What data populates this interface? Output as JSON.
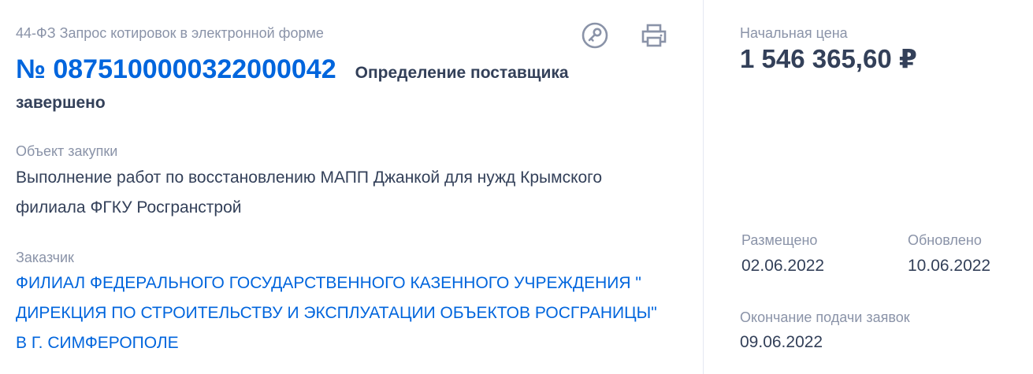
{
  "header": {
    "law_and_method": "44-ФЗ Запрос котировок в электронной форме",
    "number": "№ 0875100000322000042",
    "status": "Определение поставщика завершено",
    "actions": {
      "key_icon": "key-icon",
      "print_icon": "print-icon"
    }
  },
  "object": {
    "label": "Объект закупки",
    "text": "Выполнение работ по восстановлению МАПП Джанкой для нужд Крымского филиала ФГКУ Росгранстрой"
  },
  "customer": {
    "label": "Заказчик",
    "name": "ФИЛИАЛ ФЕДЕРАЛЬНОГО ГОСУДАРСТВЕННОГО КАЗЕННОГО УЧРЕЖДЕНИЯ \" ДИРЕКЦИЯ ПО СТРОИТЕЛЬСТВУ И ЭКСПЛУАТАЦИИ ОБЪЕКТОВ РОСГРАНИЦЫ\" В Г. СИМФЕРОПОЛЕ"
  },
  "price": {
    "label": "Начальная цена",
    "value": "1 546 365,60 ₽"
  },
  "dates": {
    "posted_label": "Размещено",
    "posted_value": "02.06.2022",
    "updated_label": "Обновлено",
    "updated_value": "10.06.2022",
    "deadline_label": "Окончание подачи заявок",
    "deadline_value": "09.06.2022"
  },
  "colors": {
    "link": "#0065dd",
    "text": "#334059",
    "muted": "#8a93a8",
    "divider": "#e4e7f2"
  }
}
